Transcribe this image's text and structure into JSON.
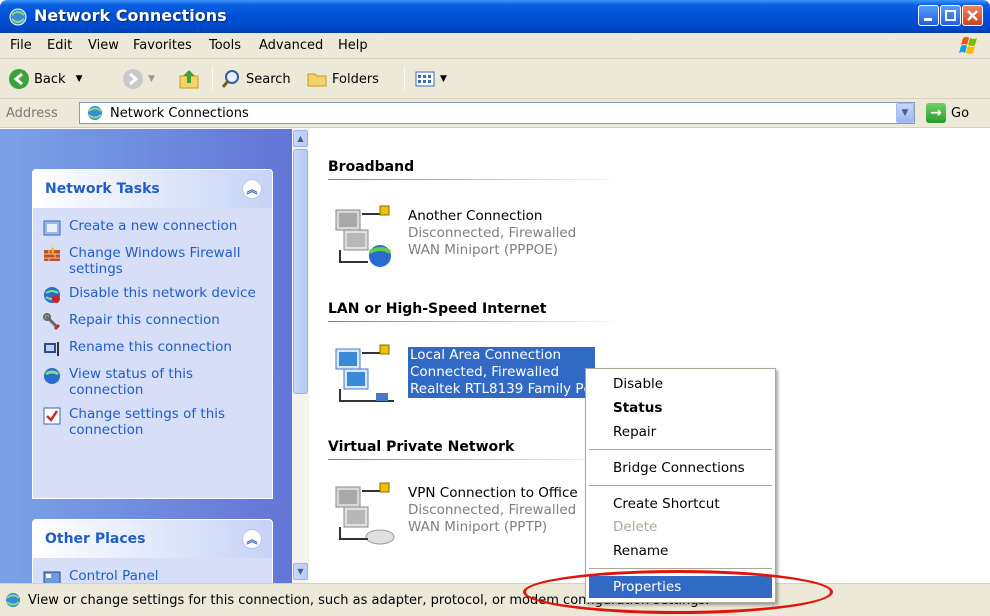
{
  "window": {
    "title": "Network Connections"
  },
  "menubar": {
    "items": [
      "File",
      "Edit",
      "View",
      "Favorites",
      "Tools",
      "Advanced",
      "Help"
    ]
  },
  "toolbar": {
    "back": "Back",
    "search": "Search",
    "folders": "Folders"
  },
  "address": {
    "label": "Address",
    "value": "Network Connections",
    "go": "Go"
  },
  "leftpane": {
    "network_tasks": {
      "title": "Network Tasks",
      "items": [
        {
          "label": "Create a new connection",
          "icon": "new-connection-icon"
        },
        {
          "label": "Change Windows Firewall settings",
          "icon": "firewall-icon"
        },
        {
          "label": "Disable this network device",
          "icon": "disable-network-icon"
        },
        {
          "label": "Repair this connection",
          "icon": "repair-icon"
        },
        {
          "label": "Rename this connection",
          "icon": "rename-icon"
        },
        {
          "label": "View status of this connection",
          "icon": "status-icon"
        },
        {
          "label": "Change settings of this connection",
          "icon": "settings-icon"
        }
      ]
    },
    "other_places": {
      "title": "Other Places",
      "items": [
        {
          "label": "Control Panel",
          "icon": "control-panel-icon"
        }
      ]
    }
  },
  "content": {
    "groups": [
      {
        "title": "Broadband",
        "connections": [
          {
            "name": "Another Connection",
            "status": "Disconnected, Firewalled",
            "device": "WAN Miniport (PPPOE)"
          }
        ]
      },
      {
        "title": "LAN or High-Speed Internet",
        "connections": [
          {
            "name": "Local Area Connection",
            "status": "Connected, Firewalled",
            "device": "Realtek RTL8139 Family Pc"
          }
        ]
      },
      {
        "title": "Virtual Private Network",
        "connections": [
          {
            "name": "VPN Connection to Office",
            "status": "Disconnected, Firewalled",
            "device": "WAN Miniport (PPTP)"
          }
        ]
      }
    ]
  },
  "context_menu": {
    "items": [
      {
        "label": "Disable"
      },
      {
        "label": "Status",
        "bold": true
      },
      {
        "label": "Repair"
      },
      {
        "label": "Bridge Connections"
      },
      {
        "label": "Create Shortcut"
      },
      {
        "label": "Delete",
        "disabled": true
      },
      {
        "label": "Rename"
      },
      {
        "label": "Properties",
        "highlighted": true
      }
    ]
  },
  "statusbar": {
    "text": "View or change settings for this connection, such as adapter, protocol, or modem configuration settings."
  },
  "colors": {
    "selection": "#316ac5",
    "link": "#215dc6",
    "annotation": "#e0140a"
  }
}
